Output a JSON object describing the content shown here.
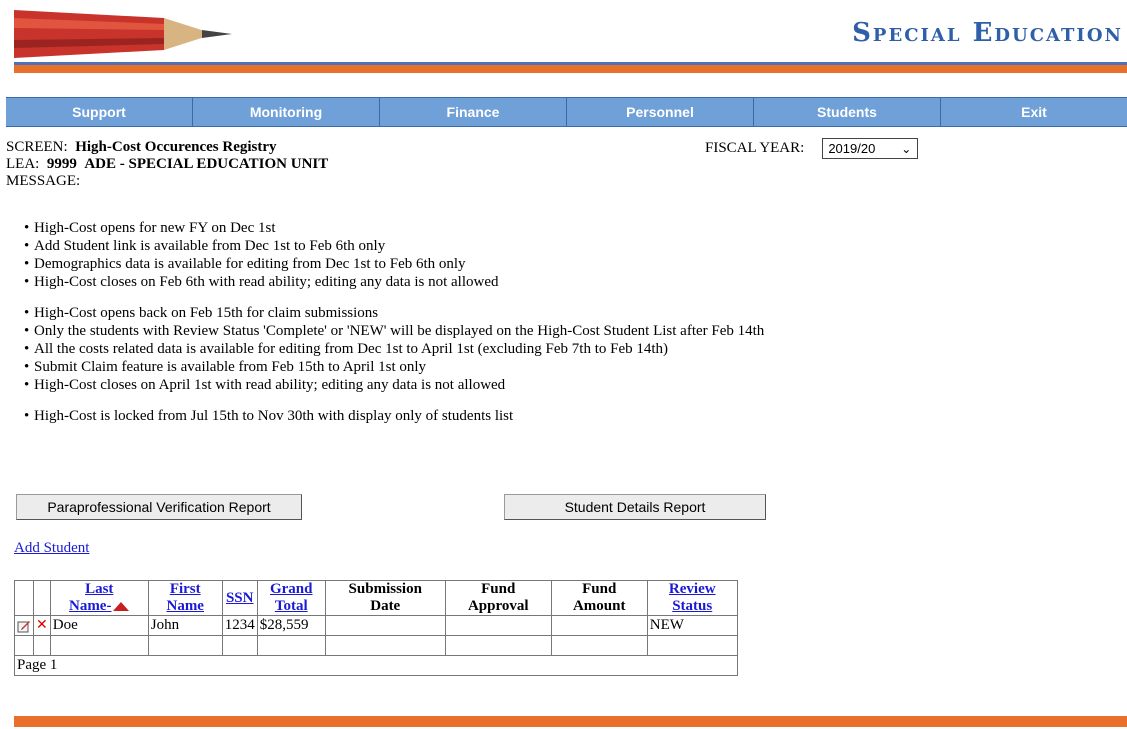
{
  "header": {
    "brand": "Special Education"
  },
  "nav": [
    "Support",
    "Monitoring",
    "Finance",
    "Personnel",
    "Students",
    "Exit"
  ],
  "screen": {
    "screen_label": "SCREEN:",
    "screen_name": "High-Cost Occurences Registry",
    "lea_label": "LEA:",
    "lea_code": "9999",
    "lea_name": "ADE - SPECIAL EDUCATION UNIT",
    "message_label": "MESSAGE:"
  },
  "fiscal_year": {
    "label": "FISCAL YEAR:",
    "value": "2019/20"
  },
  "messages": [
    [
      "High-Cost opens for new FY on Dec 1st",
      "Add Student link is available from Dec 1st to Feb 6th only",
      "Demographics data is available for editing from Dec 1st to Feb 6th only",
      "High-Cost closes on Feb 6th with read ability; editing any data is not allowed"
    ],
    [
      "High-Cost opens back on Feb 15th for claim submissions",
      "Only the students with Review Status 'Complete' or 'NEW' will be displayed on the High-Cost Student List after Feb 14th",
      "All the costs related data is available for editing from Dec 1st to April 1st (excluding Feb 7th to Feb 14th)",
      "Submit Claim feature is available from Feb 15th to April 1st only",
      "High-Cost closes on April 1st with read ability; editing any data is not allowed"
    ],
    [
      "High-Cost is locked from Jul 15th to Nov 30th with display only of students list"
    ]
  ],
  "buttons": {
    "para_report": "Paraprofessional Verification Report",
    "student_report": "Student Details Report"
  },
  "add_student": "Add Student",
  "table": {
    "headers": {
      "last_1": "Last",
      "last_2": "Name-",
      "first_1": "First",
      "first_2": "Name",
      "ssn": "SSN",
      "grand_1": "Grand",
      "grand_2": "Total",
      "sub_1": "Submission",
      "sub_2": "Date",
      "fa_1": "Fund",
      "fa_2": "Approval",
      "famt_1": "Fund",
      "famt_2": "Amount",
      "rs_1": "Review",
      "rs_2": "Status"
    },
    "rows": [
      {
        "last": "Doe",
        "first": "John",
        "ssn": "1234",
        "grand_total": "$28,559",
        "submission_date": "",
        "fund_approval": "",
        "fund_amount": "",
        "review_status": "NEW"
      }
    ],
    "pager": "Page 1"
  }
}
